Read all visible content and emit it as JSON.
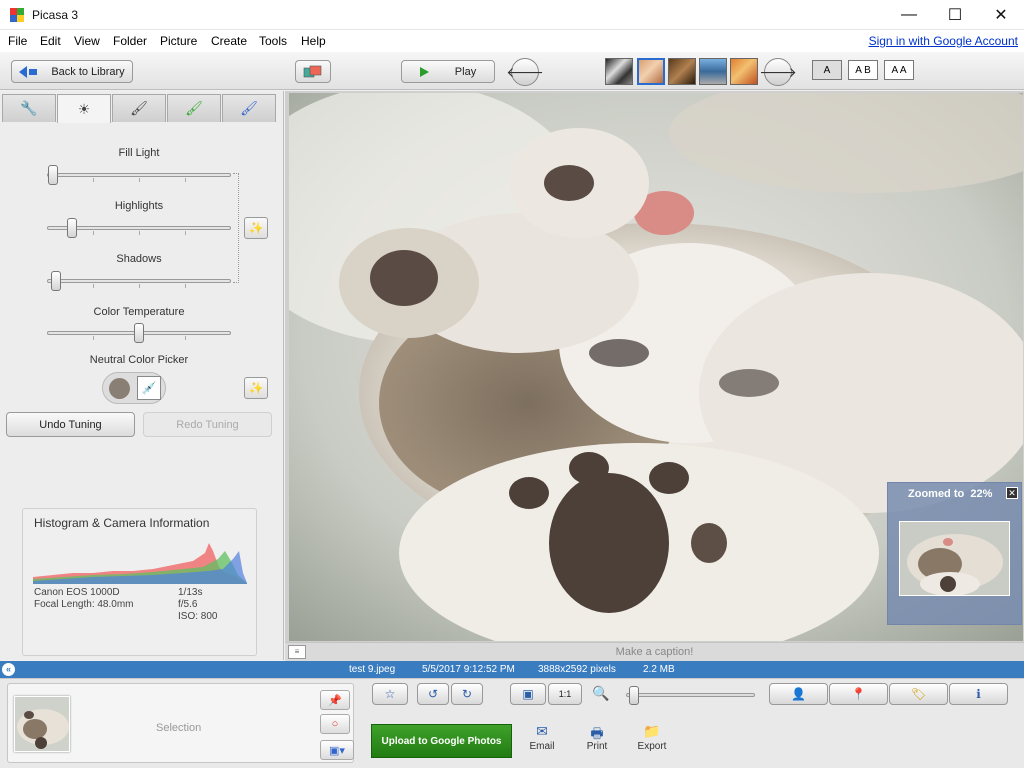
{
  "window": {
    "title": "Picasa 3",
    "minimize": "—",
    "maximize": "☐",
    "close": "✕"
  },
  "menu": {
    "items": [
      "File",
      "Edit",
      "View",
      "Folder",
      "Picture",
      "Create",
      "Tools",
      "Help"
    ],
    "sign_in": "Sign in with Google Account"
  },
  "toolbar": {
    "back_label": "Back to Library",
    "play_label": "Play",
    "prev_icon": "arrow-left-icon",
    "next_icon": "arrow-right-icon",
    "view_modes": [
      "A",
      "A B",
      "A A"
    ]
  },
  "tabs": [
    "wrench",
    "sun",
    "brush",
    "green-brush",
    "blue-brush"
  ],
  "tuning": {
    "fill_light": {
      "label": "Fill Light",
      "value": 0.0
    },
    "highlights": {
      "label": "Highlights",
      "value": 0.12
    },
    "shadows": {
      "label": "Shadows",
      "value": 0.02
    },
    "color_temperature": {
      "label": "Color Temperature",
      "value": 0.5
    },
    "neutral_color_picker": "Neutral Color Picker",
    "undo_label": "Undo Tuning",
    "redo_label": "Redo Tuning"
  },
  "histogram": {
    "title": "Histogram & Camera Information",
    "camera": "Canon EOS 1000D",
    "focal_length": "Focal Length: 48.0mm",
    "exposure": "1/13s",
    "aperture": "f/5.6",
    "iso": "ISO: 800"
  },
  "caption": {
    "placeholder": "Make a caption!"
  },
  "zoom": {
    "label": "Zoomed to",
    "value": "22%"
  },
  "info": {
    "filename": "test 9.jpeg",
    "datetime": "5/5/2017 9:12:52 PM",
    "dimensions": "3888x2592 pixels",
    "size": "2.2 MB"
  },
  "tray": {
    "selection_label": "Selection"
  },
  "actions": {
    "upload_label": "Upload to Google Photos",
    "email_label": "Email",
    "print_label": "Print",
    "export_label": "Export",
    "ratio_label": "1:1"
  },
  "colors": {
    "accent": "#3a7cc0",
    "upload": "#2e8c1e"
  }
}
